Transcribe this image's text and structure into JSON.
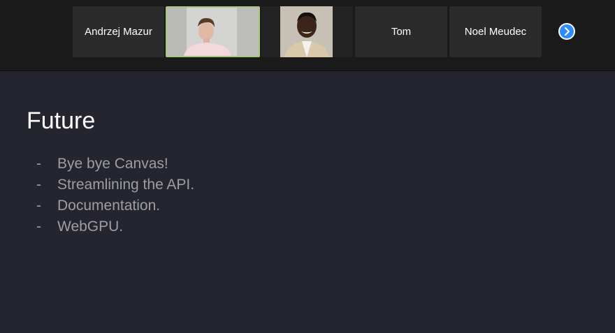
{
  "participants": [
    {
      "name": "Andrzej Mazur",
      "type": "name-only"
    },
    {
      "name": "",
      "type": "video",
      "active_speaker": true
    },
    {
      "name": "",
      "type": "photo"
    },
    {
      "name": "Tom",
      "type": "name-only"
    },
    {
      "name": "Noel Meudec",
      "type": "name-only"
    }
  ],
  "controls": {
    "next_icon": "chevron-right-icon"
  },
  "colors": {
    "accent": "#2d8cff",
    "active_speaker_border": "#a9c97a",
    "slide_background": "#25252f",
    "bullet_text": "#9d9da3"
  },
  "slide": {
    "title": "Future",
    "bullets": [
      "Bye bye Canvas!",
      "Streamlining the API.",
      "Documentation.",
      "WebGPU."
    ]
  }
}
